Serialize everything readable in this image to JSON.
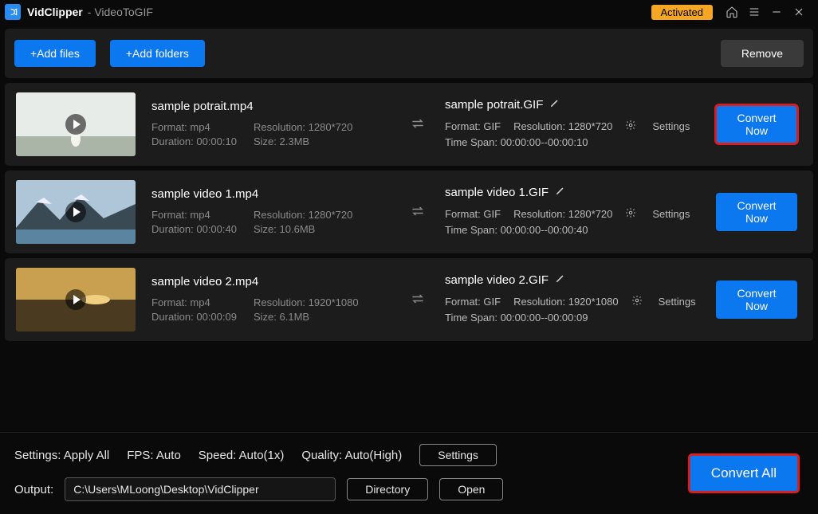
{
  "titlebar": {
    "app_name": "VidClipper",
    "subtitle": "- VideoToGIF",
    "activated": "Activated"
  },
  "toolbar": {
    "add_files": "+Add files",
    "add_folders": "+Add folders",
    "remove": "Remove"
  },
  "rows": [
    {
      "src_name": "sample potrait.mp4",
      "src_format": "Format: mp4",
      "src_res": "Resolution: 1280*720",
      "src_dur": "Duration: 00:00:10",
      "src_size": "Size: 2.3MB",
      "dst_name": "sample potrait.GIF",
      "dst_format": "Format: GIF",
      "dst_res": "Resolution: 1280*720",
      "dst_span": "Time Span: 00:00:00--00:00:10",
      "settings": "Settings",
      "convert": "Convert Now",
      "highlight": true,
      "thumb_style": "sky"
    },
    {
      "src_name": "sample video 1.mp4",
      "src_format": "Format: mp4",
      "src_res": "Resolution: 1280*720",
      "src_dur": "Duration: 00:00:40",
      "src_size": "Size: 10.6MB",
      "dst_name": "sample video 1.GIF",
      "dst_format": "Format: GIF",
      "dst_res": "Resolution: 1280*720",
      "dst_span": "Time Span: 00:00:00--00:00:40",
      "settings": "Settings",
      "convert": "Convert Now",
      "highlight": false,
      "thumb_style": "mountain"
    },
    {
      "src_name": "sample video 2.mp4",
      "src_format": "Format: mp4",
      "src_res": "Resolution: 1920*1080",
      "src_dur": "Duration: 00:00:09",
      "src_size": "Size: 6.1MB",
      "dst_name": "sample video 2.GIF",
      "dst_format": "Format: GIF",
      "dst_res": "Resolution: 1920*1080",
      "dst_span": "Time Span: 00:00:00--00:00:09",
      "settings": "Settings",
      "convert": "Convert Now",
      "highlight": false,
      "thumb_style": "sunset"
    }
  ],
  "bottom": {
    "settings_apply": "Settings: Apply All",
    "fps": "FPS: Auto",
    "speed": "Speed: Auto(1x)",
    "quality": "Quality: Auto(High)",
    "settings_btn": "Settings",
    "output_label": "Output:",
    "output_path": "C:\\Users\\MLoong\\Desktop\\VidClipper",
    "directory": "Directory",
    "open": "Open",
    "convert_all": "Convert All"
  }
}
